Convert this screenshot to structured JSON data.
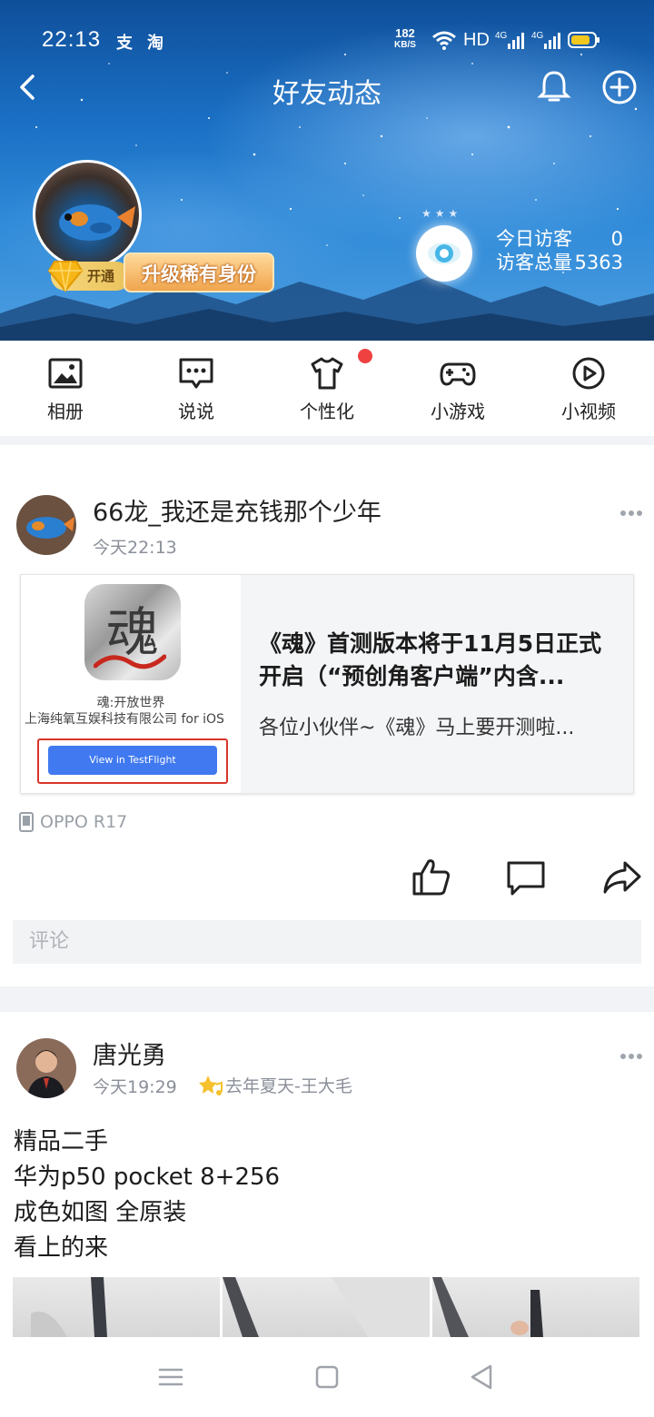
{
  "status_bar": {
    "time": "22:13",
    "app_icons": [
      "支",
      "淘"
    ],
    "net_speed": "182",
    "net_speed_unit": "KB/S",
    "hd_label": "HD",
    "signal_labels": [
      "4G",
      "4G"
    ]
  },
  "nav": {
    "title": "好友动态"
  },
  "profile": {
    "vip_label": "开通",
    "upgrade_label": "升级稀有身份",
    "visitors": [
      {
        "label": "今日访客",
        "value": "0"
      },
      {
        "label": "访客总量",
        "value": "5363"
      }
    ]
  },
  "quick_menu": [
    {
      "label": "相册",
      "icon": "photo-album-icon"
    },
    {
      "label": "说说",
      "icon": "message-bubble-icon"
    },
    {
      "label": "个性化",
      "icon": "tshirt-icon",
      "has_dot": true
    },
    {
      "label": "小游戏",
      "icon": "gamepad-icon"
    },
    {
      "label": "小视频",
      "icon": "play-circle-icon"
    }
  ],
  "post1": {
    "author": "66龙_我还是充钱那个少年",
    "time": "今天22:13",
    "card": {
      "app_glyph": "魂",
      "app_name": "魂:开放世界",
      "company": "上海纯氧互娱科技有限公司 for iOS",
      "button_label": "View in TestFlight",
      "title": "《魂》首测版本将于11月5日正式开启（“预创角客户端”内含...",
      "description": "各位小伙伴~《魂》马上要开测啦..."
    },
    "device": "OPPO R17",
    "comment_placeholder": "评论"
  },
  "post2": {
    "author": "唐光勇",
    "time": "今天19:29",
    "tag": "去年夏天-王大毛",
    "text_lines": [
      "精品二手",
      "华为p50 pocket 8+256",
      "成色如图 全原装",
      "看上的来"
    ]
  },
  "colors": {
    "accent_red": "#f04141",
    "banner_blue": "#1a6fc4",
    "testflight_blue": "#4079f0"
  }
}
